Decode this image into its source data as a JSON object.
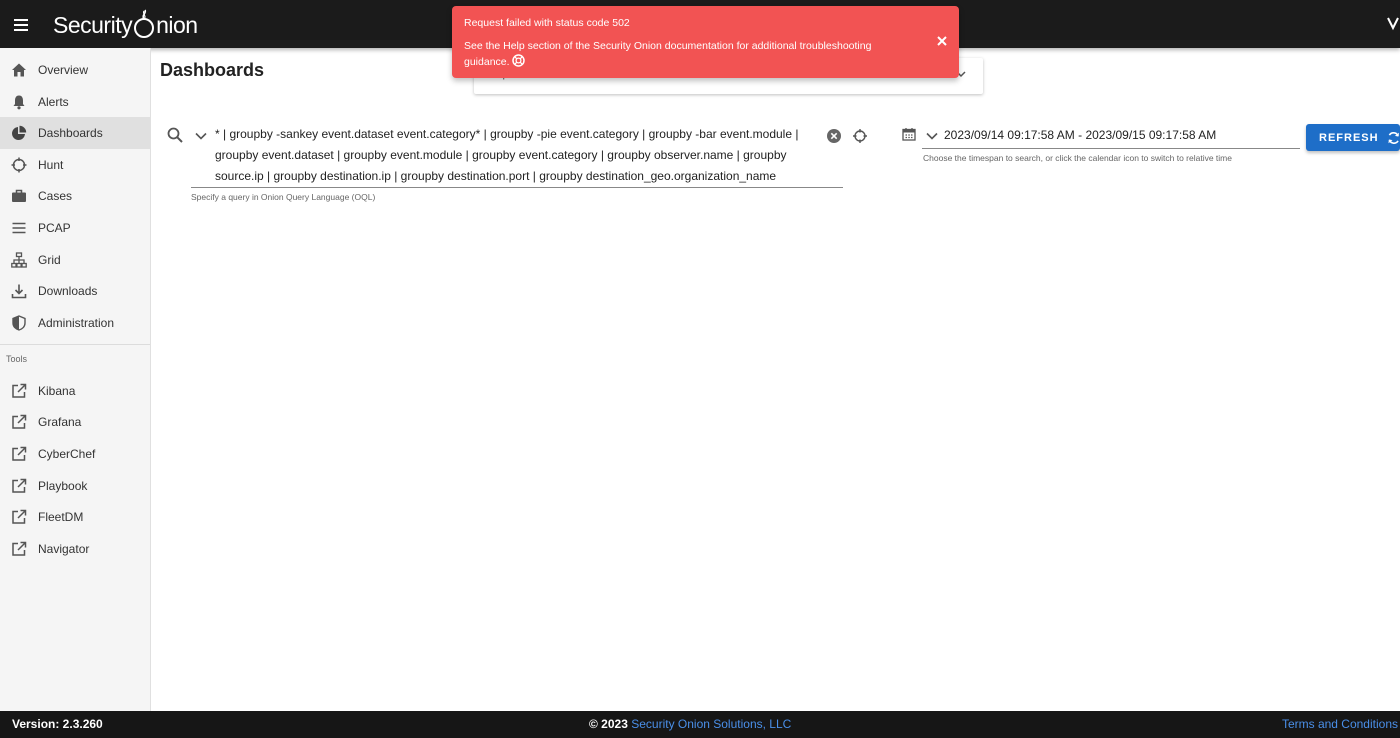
{
  "header": {
    "logo_text_left": "Security",
    "logo_text_right": "nion",
    "menu_icon": "hamburger-menu-icon"
  },
  "sidebar": {
    "items": [
      {
        "label": "Overview",
        "icon": "home-icon"
      },
      {
        "label": "Alerts",
        "icon": "bell-icon"
      },
      {
        "label": "Dashboards",
        "icon": "pie-chart-icon",
        "active": true
      },
      {
        "label": "Hunt",
        "icon": "crosshair-icon"
      },
      {
        "label": "Cases",
        "icon": "briefcase-icon"
      },
      {
        "label": "PCAP",
        "icon": "list-icon"
      },
      {
        "label": "Grid",
        "icon": "sitemap-icon"
      },
      {
        "label": "Downloads",
        "icon": "download-icon"
      },
      {
        "label": "Administration",
        "icon": "shield-icon"
      }
    ],
    "tools_header": "Tools",
    "tools": [
      {
        "label": "Kibana",
        "icon": "external-link-icon"
      },
      {
        "label": "Grafana",
        "icon": "external-link-icon"
      },
      {
        "label": "CyberChef",
        "icon": "external-link-icon"
      },
      {
        "label": "Playbook",
        "icon": "external-link-icon"
      },
      {
        "label": "FleetDM",
        "icon": "external-link-icon"
      },
      {
        "label": "Navigator",
        "icon": "external-link-icon"
      }
    ]
  },
  "main": {
    "title": "Dashboards",
    "query": {
      "value": "* | groupby -sankey event.dataset event.category* | groupby -pie event.category | groupby -bar event.module | groupby event.dataset | groupby event.module | groupby event.category | groupby observer.name | groupby source.ip | groupby destination.ip | groupby destination.port | groupby destination_geo.organization_name",
      "hint": "Specify a query in Onion Query Language (OQL)"
    },
    "daterange": {
      "value": "2023/09/14 09:17:58 AM - 2023/09/15 09:17:58 AM",
      "hint": "Choose the timespan to search, or click the calendar icon to switch to relative time"
    },
    "refresh_label": "REFRESH",
    "options_label": "Options"
  },
  "toast": {
    "title": "Request failed with status code 502",
    "message": "See the Help section of the Security Onion documentation for additional troubleshooting guidance.",
    "color": "#f25353"
  },
  "footer": {
    "version": "Version: 2.3.260",
    "copyright_prefix": "© 2023",
    "company": "Security Onion Solutions, LLC",
    "terms": "Terms and Conditions"
  },
  "colors": {
    "accent": "#1e6ec8",
    "topbar": "#1b1b1b",
    "link": "#4a8fe8"
  }
}
